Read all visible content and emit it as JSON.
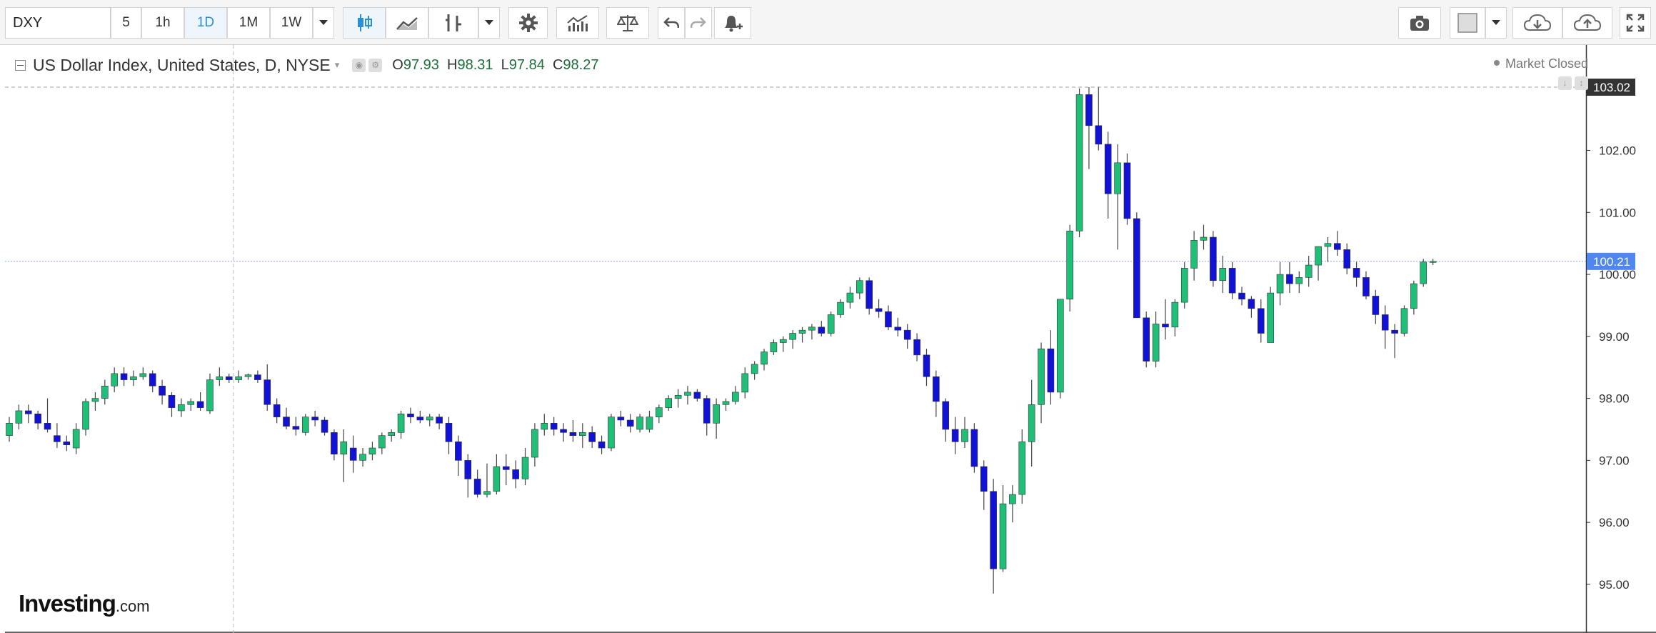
{
  "toolbar": {
    "symbol": "DXY",
    "intervals": [
      {
        "label": "5",
        "active": false
      },
      {
        "label": "1h",
        "active": false
      },
      {
        "label": "1D",
        "active": true
      },
      {
        "label": "1M",
        "active": false
      },
      {
        "label": "1W",
        "active": false
      }
    ],
    "icons_left": [
      "dropdown-caret-icon",
      "candlestick-icon",
      "area-chart-icon",
      "indicator-icon",
      "dropdown-caret-icon",
      "settings-gear-icon",
      "studies-icon",
      "compare-scale-icon",
      "undo-icon",
      "redo-icon",
      "alert-bell-icon"
    ],
    "icons_right": [
      "camera-icon",
      "color-swatch-icon",
      "dropdown-caret-icon",
      "cloud-download-icon",
      "cloud-upload-icon",
      "fullscreen-icon"
    ]
  },
  "legend": {
    "title": "US Dollar Index, United States, D, NYSE",
    "open_label": "O",
    "open": "97.93",
    "high_label": "H",
    "high": "98.31",
    "low_label": "L",
    "low": "97.84",
    "close_label": "C",
    "close": "98.27"
  },
  "status": {
    "text": "Market Closed"
  },
  "logo": {
    "brand": "Investing",
    "suffix": ".com"
  },
  "colors": {
    "up": "#1fbf77",
    "down": "#1212d6",
    "wick": "#444444",
    "crosshair": "#8fa9e0",
    "price_tag": "#4f87ef",
    "max_tag": "#333333"
  },
  "chart_data": {
    "type": "candlestick",
    "title": "US Dollar Index, United States, D, NYSE",
    "ylim": [
      94.25,
      103.7
    ],
    "y_ticks": [
      "95.00",
      "96.00",
      "97.00",
      "98.00",
      "99.00",
      "100.00",
      "101.00",
      "102.00"
    ],
    "price_markers": [
      {
        "label": "103.02",
        "value": 103.02,
        "style": "dark"
      },
      {
        "label": "100.21",
        "value": 100.21,
        "style": "blue"
      }
    ],
    "grid": false,
    "candles": [
      [
        97.4,
        97.7,
        97.3,
        97.6
      ],
      [
        97.6,
        97.9,
        97.5,
        97.8
      ],
      [
        97.8,
        97.9,
        97.6,
        97.75
      ],
      [
        97.75,
        97.8,
        97.5,
        97.6
      ],
      [
        97.6,
        98.0,
        97.45,
        97.5
      ],
      [
        97.4,
        97.6,
        97.2,
        97.3
      ],
      [
        97.3,
        97.4,
        97.15,
        97.25
      ],
      [
        97.2,
        97.6,
        97.1,
        97.5
      ],
      [
        97.5,
        98.0,
        97.4,
        97.95
      ],
      [
        97.95,
        98.1,
        97.8,
        98.0
      ],
      [
        98.0,
        98.3,
        97.9,
        98.2
      ],
      [
        98.2,
        98.5,
        98.1,
        98.4
      ],
      [
        98.4,
        98.5,
        98.2,
        98.3
      ],
      [
        98.3,
        98.45,
        98.2,
        98.35
      ],
      [
        98.35,
        98.5,
        98.3,
        98.4
      ],
      [
        98.4,
        98.45,
        98.1,
        98.2
      ],
      [
        98.2,
        98.3,
        97.9,
        98.05
      ],
      [
        98.05,
        98.1,
        97.7,
        97.85
      ],
      [
        97.8,
        98.0,
        97.7,
        97.9
      ],
      [
        97.9,
        98.0,
        97.8,
        97.95
      ],
      [
        97.95,
        98.1,
        97.8,
        97.85
      ],
      [
        97.8,
        98.4,
        97.75,
        98.3
      ],
      [
        98.3,
        98.5,
        98.2,
        98.35
      ],
      [
        98.35,
        98.4,
        98.25,
        98.3
      ],
      [
        98.3,
        98.45,
        98.25,
        98.35
      ],
      [
        98.35,
        98.4,
        98.3,
        98.38
      ],
      [
        98.38,
        98.45,
        98.25,
        98.3
      ],
      [
        98.3,
        98.55,
        97.8,
        97.9
      ],
      [
        97.9,
        98.0,
        97.6,
        97.7
      ],
      [
        97.7,
        97.85,
        97.5,
        97.55
      ],
      [
        97.55,
        97.7,
        97.4,
        97.5
      ],
      [
        97.45,
        97.75,
        97.4,
        97.7
      ],
      [
        97.7,
        97.8,
        97.55,
        97.65
      ],
      [
        97.65,
        97.7,
        97.4,
        97.45
      ],
      [
        97.45,
        97.5,
        97.0,
        97.1
      ],
      [
        97.1,
        97.5,
        96.65,
        97.3
      ],
      [
        97.2,
        97.4,
        96.8,
        97.0
      ],
      [
        97.0,
        97.2,
        96.9,
        97.1
      ],
      [
        97.1,
        97.3,
        97.0,
        97.2
      ],
      [
        97.2,
        97.45,
        97.1,
        97.4
      ],
      [
        97.4,
        97.5,
        97.3,
        97.45
      ],
      [
        97.45,
        97.8,
        97.35,
        97.75
      ],
      [
        97.75,
        97.85,
        97.6,
        97.7
      ],
      [
        97.7,
        97.8,
        97.6,
        97.65
      ],
      [
        97.65,
        97.75,
        97.55,
        97.7
      ],
      [
        97.7,
        97.75,
        97.5,
        97.6
      ],
      [
        97.6,
        97.7,
        97.1,
        97.3
      ],
      [
        97.3,
        97.4,
        96.75,
        97.0
      ],
      [
        97.0,
        97.1,
        96.4,
        96.7
      ],
      [
        96.7,
        96.85,
        96.4,
        96.45
      ],
      [
        96.45,
        96.95,
        96.4,
        96.5
      ],
      [
        96.5,
        97.1,
        96.45,
        96.9
      ],
      [
        96.9,
        97.1,
        96.6,
        96.85
      ],
      [
        96.85,
        97.0,
        96.55,
        96.7
      ],
      [
        96.7,
        97.2,
        96.6,
        97.05
      ],
      [
        97.05,
        97.6,
        96.9,
        97.5
      ],
      [
        97.5,
        97.75,
        97.4,
        97.6
      ],
      [
        97.6,
        97.7,
        97.4,
        97.5
      ],
      [
        97.5,
        97.6,
        97.3,
        97.45
      ],
      [
        97.45,
        97.65,
        97.3,
        97.4
      ],
      [
        97.4,
        97.6,
        97.2,
        97.45
      ],
      [
        97.45,
        97.55,
        97.2,
        97.3
      ],
      [
        97.3,
        97.4,
        97.1,
        97.2
      ],
      [
        97.2,
        97.75,
        97.15,
        97.7
      ],
      [
        97.7,
        97.8,
        97.55,
        97.65
      ],
      [
        97.65,
        97.75,
        97.45,
        97.55
      ],
      [
        97.5,
        97.75,
        97.45,
        97.7
      ],
      [
        97.5,
        97.8,
        97.45,
        97.7
      ],
      [
        97.7,
        97.9,
        97.6,
        97.85
      ],
      [
        97.85,
        98.05,
        97.8,
        98.0
      ],
      [
        98.0,
        98.15,
        97.85,
        98.05
      ],
      [
        98.05,
        98.2,
        97.9,
        98.1
      ],
      [
        98.1,
        98.15,
        97.95,
        98.0
      ],
      [
        98.0,
        98.05,
        97.4,
        97.6
      ],
      [
        97.6,
        98.0,
        97.35,
        97.9
      ],
      [
        97.9,
        98.0,
        97.8,
        97.95
      ],
      [
        97.95,
        98.2,
        97.9,
        98.1
      ],
      [
        98.1,
        98.5,
        98.0,
        98.4
      ],
      [
        98.4,
        98.6,
        98.3,
        98.55
      ],
      [
        98.55,
        98.8,
        98.45,
        98.75
      ],
      [
        98.75,
        98.95,
        98.7,
        98.9
      ],
      [
        98.9,
        99.0,
        98.75,
        98.95
      ],
      [
        98.95,
        99.1,
        98.8,
        99.05
      ],
      [
        99.05,
        99.15,
        98.9,
        99.1
      ],
      [
        99.1,
        99.2,
        98.95,
        99.15
      ],
      [
        99.15,
        99.25,
        99.0,
        99.05
      ],
      [
        99.05,
        99.4,
        99.0,
        99.35
      ],
      [
        99.35,
        99.6,
        99.3,
        99.55
      ],
      [
        99.55,
        99.8,
        99.45,
        99.7
      ],
      [
        99.7,
        99.95,
        99.6,
        99.9
      ],
      [
        99.9,
        99.95,
        99.35,
        99.45
      ],
      [
        99.45,
        99.6,
        99.3,
        99.4
      ],
      [
        99.4,
        99.5,
        99.1,
        99.15
      ],
      [
        99.15,
        99.3,
        99.0,
        99.1
      ],
      [
        99.1,
        99.2,
        98.8,
        98.95
      ],
      [
        98.95,
        99.05,
        98.6,
        98.7
      ],
      [
        98.7,
        98.8,
        98.2,
        98.35
      ],
      [
        98.35,
        98.45,
        97.7,
        97.95
      ],
      [
        97.95,
        98.0,
        97.3,
        97.5
      ],
      [
        97.5,
        97.7,
        97.1,
        97.3
      ],
      [
        97.3,
        97.7,
        97.2,
        97.5
      ],
      [
        97.5,
        97.6,
        96.8,
        96.9
      ],
      [
        96.9,
        97.0,
        96.2,
        96.5
      ],
      [
        96.5,
        96.7,
        94.85,
        95.25
      ],
      [
        95.25,
        96.6,
        95.2,
        96.3
      ],
      [
        96.3,
        96.6,
        96.0,
        96.45
      ],
      [
        96.45,
        97.5,
        96.3,
        97.3
      ],
      [
        97.3,
        98.3,
        96.9,
        97.9
      ],
      [
        97.9,
        98.9,
        97.6,
        98.8
      ],
      [
        98.8,
        99.1,
        97.9,
        98.1
      ],
      [
        98.1,
        99.6,
        98.0,
        99.6
      ],
      [
        99.6,
        100.8,
        99.4,
        100.7
      ],
      [
        100.7,
        103.0,
        100.6,
        102.9
      ],
      [
        102.9,
        103.02,
        101.7,
        102.4
      ],
      [
        102.4,
        103.02,
        102.0,
        102.1
      ],
      [
        102.1,
        102.3,
        100.9,
        101.3
      ],
      [
        101.3,
        102.1,
        100.4,
        101.8
      ],
      [
        101.8,
        101.95,
        100.8,
        100.9
      ],
      [
        100.9,
        101.0,
        99.3,
        99.3
      ],
      [
        99.3,
        99.4,
        98.5,
        98.6
      ],
      [
        98.6,
        99.4,
        98.5,
        99.2
      ],
      [
        99.2,
        99.6,
        98.95,
        99.15
      ],
      [
        99.15,
        99.6,
        99.0,
        99.55
      ],
      [
        99.55,
        100.2,
        99.45,
        100.1
      ],
      [
        100.1,
        100.7,
        99.9,
        100.55
      ],
      [
        100.55,
        100.8,
        100.4,
        100.6
      ],
      [
        100.6,
        100.7,
        99.8,
        99.9
      ],
      [
        99.9,
        100.3,
        99.7,
        100.1
      ],
      [
        100.1,
        100.2,
        99.6,
        99.7
      ],
      [
        99.7,
        99.8,
        99.5,
        99.6
      ],
      [
        99.6,
        99.65,
        99.3,
        99.45
      ],
      [
        99.45,
        99.6,
        98.9,
        99.05
      ],
      [
        98.9,
        99.8,
        98.9,
        99.7
      ],
      [
        99.7,
        100.2,
        99.5,
        100.0
      ],
      [
        100.0,
        100.2,
        99.7,
        99.85
      ],
      [
        99.85,
        100.05,
        99.7,
        99.95
      ],
      [
        99.95,
        100.3,
        99.8,
        100.15
      ],
      [
        100.15,
        100.3,
        99.9,
        100.45
      ],
      [
        100.45,
        100.6,
        100.2,
        100.5
      ],
      [
        100.5,
        100.7,
        100.3,
        100.4
      ],
      [
        100.4,
        100.5,
        100.0,
        100.1
      ],
      [
        100.1,
        100.2,
        99.8,
        99.95
      ],
      [
        99.95,
        100.05,
        99.6,
        99.65
      ],
      [
        99.65,
        99.75,
        99.2,
        99.35
      ],
      [
        99.35,
        99.5,
        98.8,
        99.1
      ],
      [
        99.1,
        99.2,
        98.65,
        99.05
      ],
      [
        99.05,
        99.5,
        99.0,
        99.45
      ],
      [
        99.45,
        99.9,
        99.35,
        99.85
      ],
      [
        99.85,
        100.25,
        99.8,
        100.2
      ],
      [
        100.2,
        100.25,
        100.15,
        100.21
      ]
    ]
  }
}
